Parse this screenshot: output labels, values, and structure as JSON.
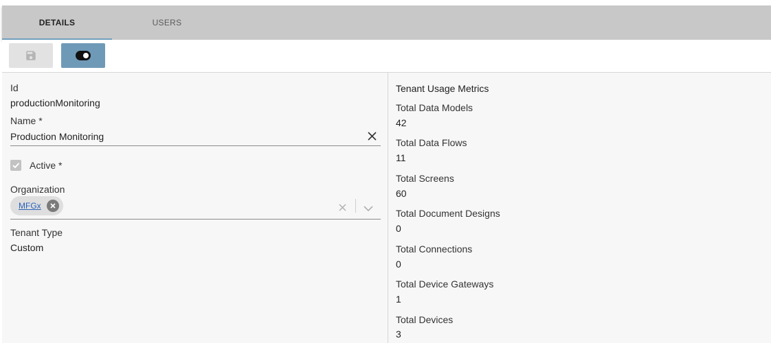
{
  "tabs": [
    {
      "label": "DETAILS",
      "active": true
    },
    {
      "label": "USERS",
      "active": false
    }
  ],
  "toolbar": {
    "save_icon": "save-icon",
    "toggle_icon": "toggle-icon"
  },
  "form": {
    "id_label": "Id",
    "id_value": "productionMonitoring",
    "name_label": "Name *",
    "name_value": "Production Monitoring",
    "active_label": "Active *",
    "active_checked": true,
    "organization_label": "Organization",
    "organization_chip": "MFGx",
    "tenant_type_label": "Tenant Type",
    "tenant_type_value": "Custom"
  },
  "metrics": {
    "title": "Tenant Usage Metrics",
    "items": [
      {
        "label": "Total Data Models",
        "value": "42"
      },
      {
        "label": "Total Data Flows",
        "value": "11"
      },
      {
        "label": "Total Screens",
        "value": "60"
      },
      {
        "label": "Total Document Designs",
        "value": "0"
      },
      {
        "label": "Total Connections",
        "value": "0"
      },
      {
        "label": "Total Device Gateways",
        "value": "1"
      },
      {
        "label": "Total Devices",
        "value": "3"
      }
    ]
  },
  "colors": {
    "tab_indicator": "#6f9fbd",
    "toggle_button": "#6f9ab7",
    "chip_link": "#2a62b8"
  }
}
